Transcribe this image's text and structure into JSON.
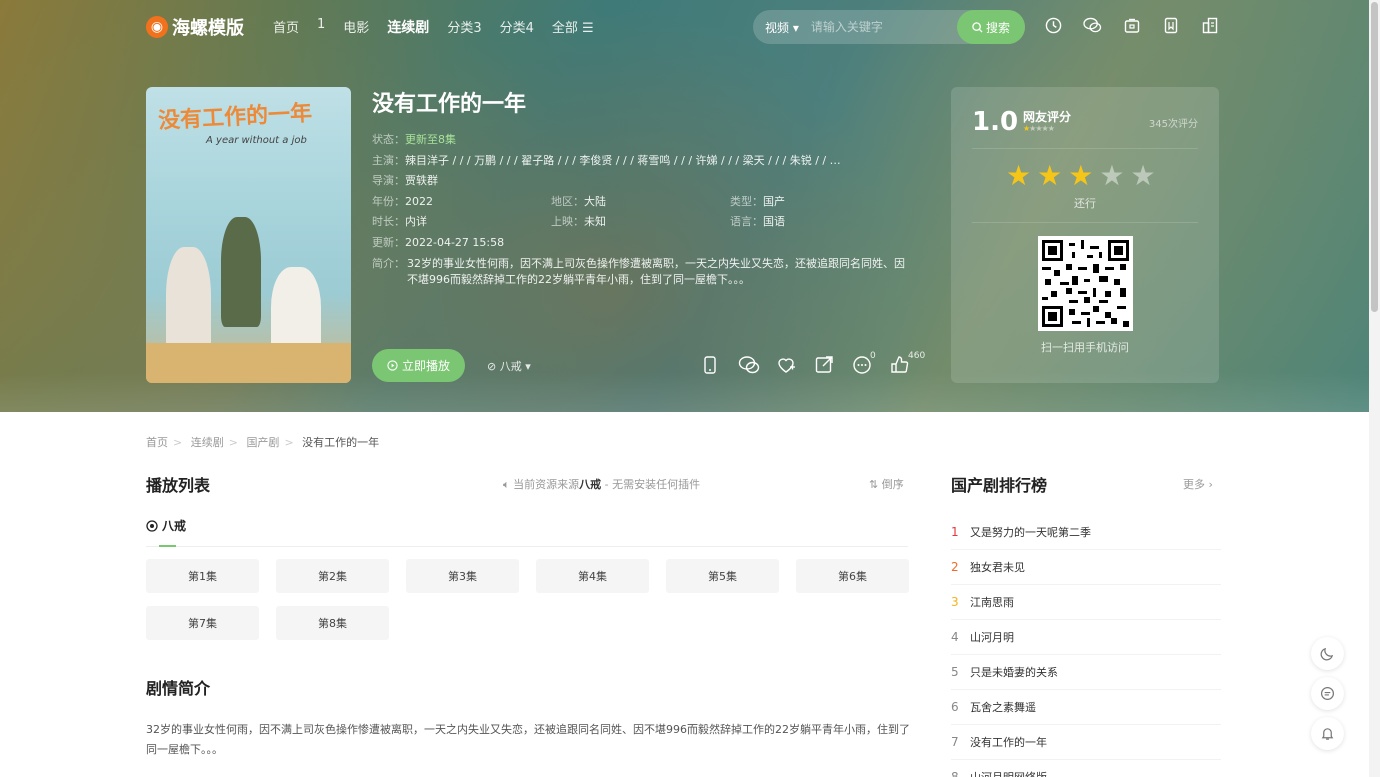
{
  "nav": {
    "logo": "海螺模版",
    "links": [
      "首页",
      "1",
      "电影",
      "连续剧",
      "分类3",
      "分类4",
      "全部 ☰"
    ],
    "active_index": 3,
    "search_type": "视频",
    "search_placeholder": "请输入关键字",
    "search_button": "搜索",
    "icons": [
      "history-icon",
      "wechat-icon",
      "box-icon",
      "bookmark-icon",
      "building-icon"
    ]
  },
  "video": {
    "title": "没有工作的一年",
    "poster_title": "没有工作的一年",
    "poster_sub": "A year without a job",
    "status_label": "状态：",
    "status": "更新至8集",
    "cast_label": "主演：",
    "cast": "辣目洋子 / / / 万鹏 / / / 翟子路 / / / 李俊贤 / / / 蒋雪鸣 / / / 许娣 / / / 梁天 / / / 朱锐 / / …",
    "director_label": "导演：",
    "director": "贾轶群",
    "year_label": "年份：",
    "year": "2022",
    "region_label": "地区：",
    "region": "大陆",
    "type_label": "类型：",
    "type": "国产",
    "duration_label": "时长：",
    "duration": "内详",
    "release_label": "上映：",
    "release": "未知",
    "language_label": "语言：",
    "language": "国语",
    "updated_label": "更新：",
    "updated": "2022-04-27 15:58",
    "intro_label": "简介：",
    "intro": "32岁的事业女性何雨，因不满上司灰色操作惨遭被离职，一天之内失业又失恋，还被追跟同名同姓、因不堪996而毅然辞掉工作的22岁躺平青年小雨，住到了同一屋檐下。。。"
  },
  "actions": {
    "play": "立即播放",
    "source": "八戒",
    "comment_count": "0",
    "like_count": "460"
  },
  "rating": {
    "score": "1.0",
    "label": "网友评分",
    "count": "345次评分",
    "stars_on": 3,
    "stars_total": 5,
    "verdict": "还行",
    "qr_caption": "扫一扫用手机访问"
  },
  "breadcrumb": [
    "首页",
    "连续剧",
    "国产剧",
    "没有工作的一年"
  ],
  "playlist": {
    "title": "播放列表",
    "source_tip_prefix": "当前资源来源",
    "source_name": "八戒",
    "source_tip_suffix": " - 无需安装任何插件",
    "sort": "倒序",
    "tab": "八戒",
    "episodes": [
      "第1集",
      "第2集",
      "第3集",
      "第4集",
      "第5集",
      "第6集",
      "第7集",
      "第8集"
    ]
  },
  "synopsis": {
    "title": "剧情简介",
    "text": "32岁的事业女性何雨，因不满上司灰色操作惨遭被离职，一天之内失业又失恋，还被追跟同名同姓、因不堪996而毅然辞掉工作的22岁躺平青年小雨，住到了同一屋檐下。。。"
  },
  "ranking": {
    "title": "国产剧排行榜",
    "more": "更多",
    "items": [
      "又是努力的一天呢第二季",
      "独女君未见",
      "江南思雨",
      "山河月明",
      "只是未婚妻的关系",
      "瓦舍之素舞遥",
      "没有工作的一年",
      "山河月明网络版"
    ]
  },
  "colors": {
    "accent": "#7bc672",
    "star": "#f5c518",
    "logo": "#f2711c"
  }
}
